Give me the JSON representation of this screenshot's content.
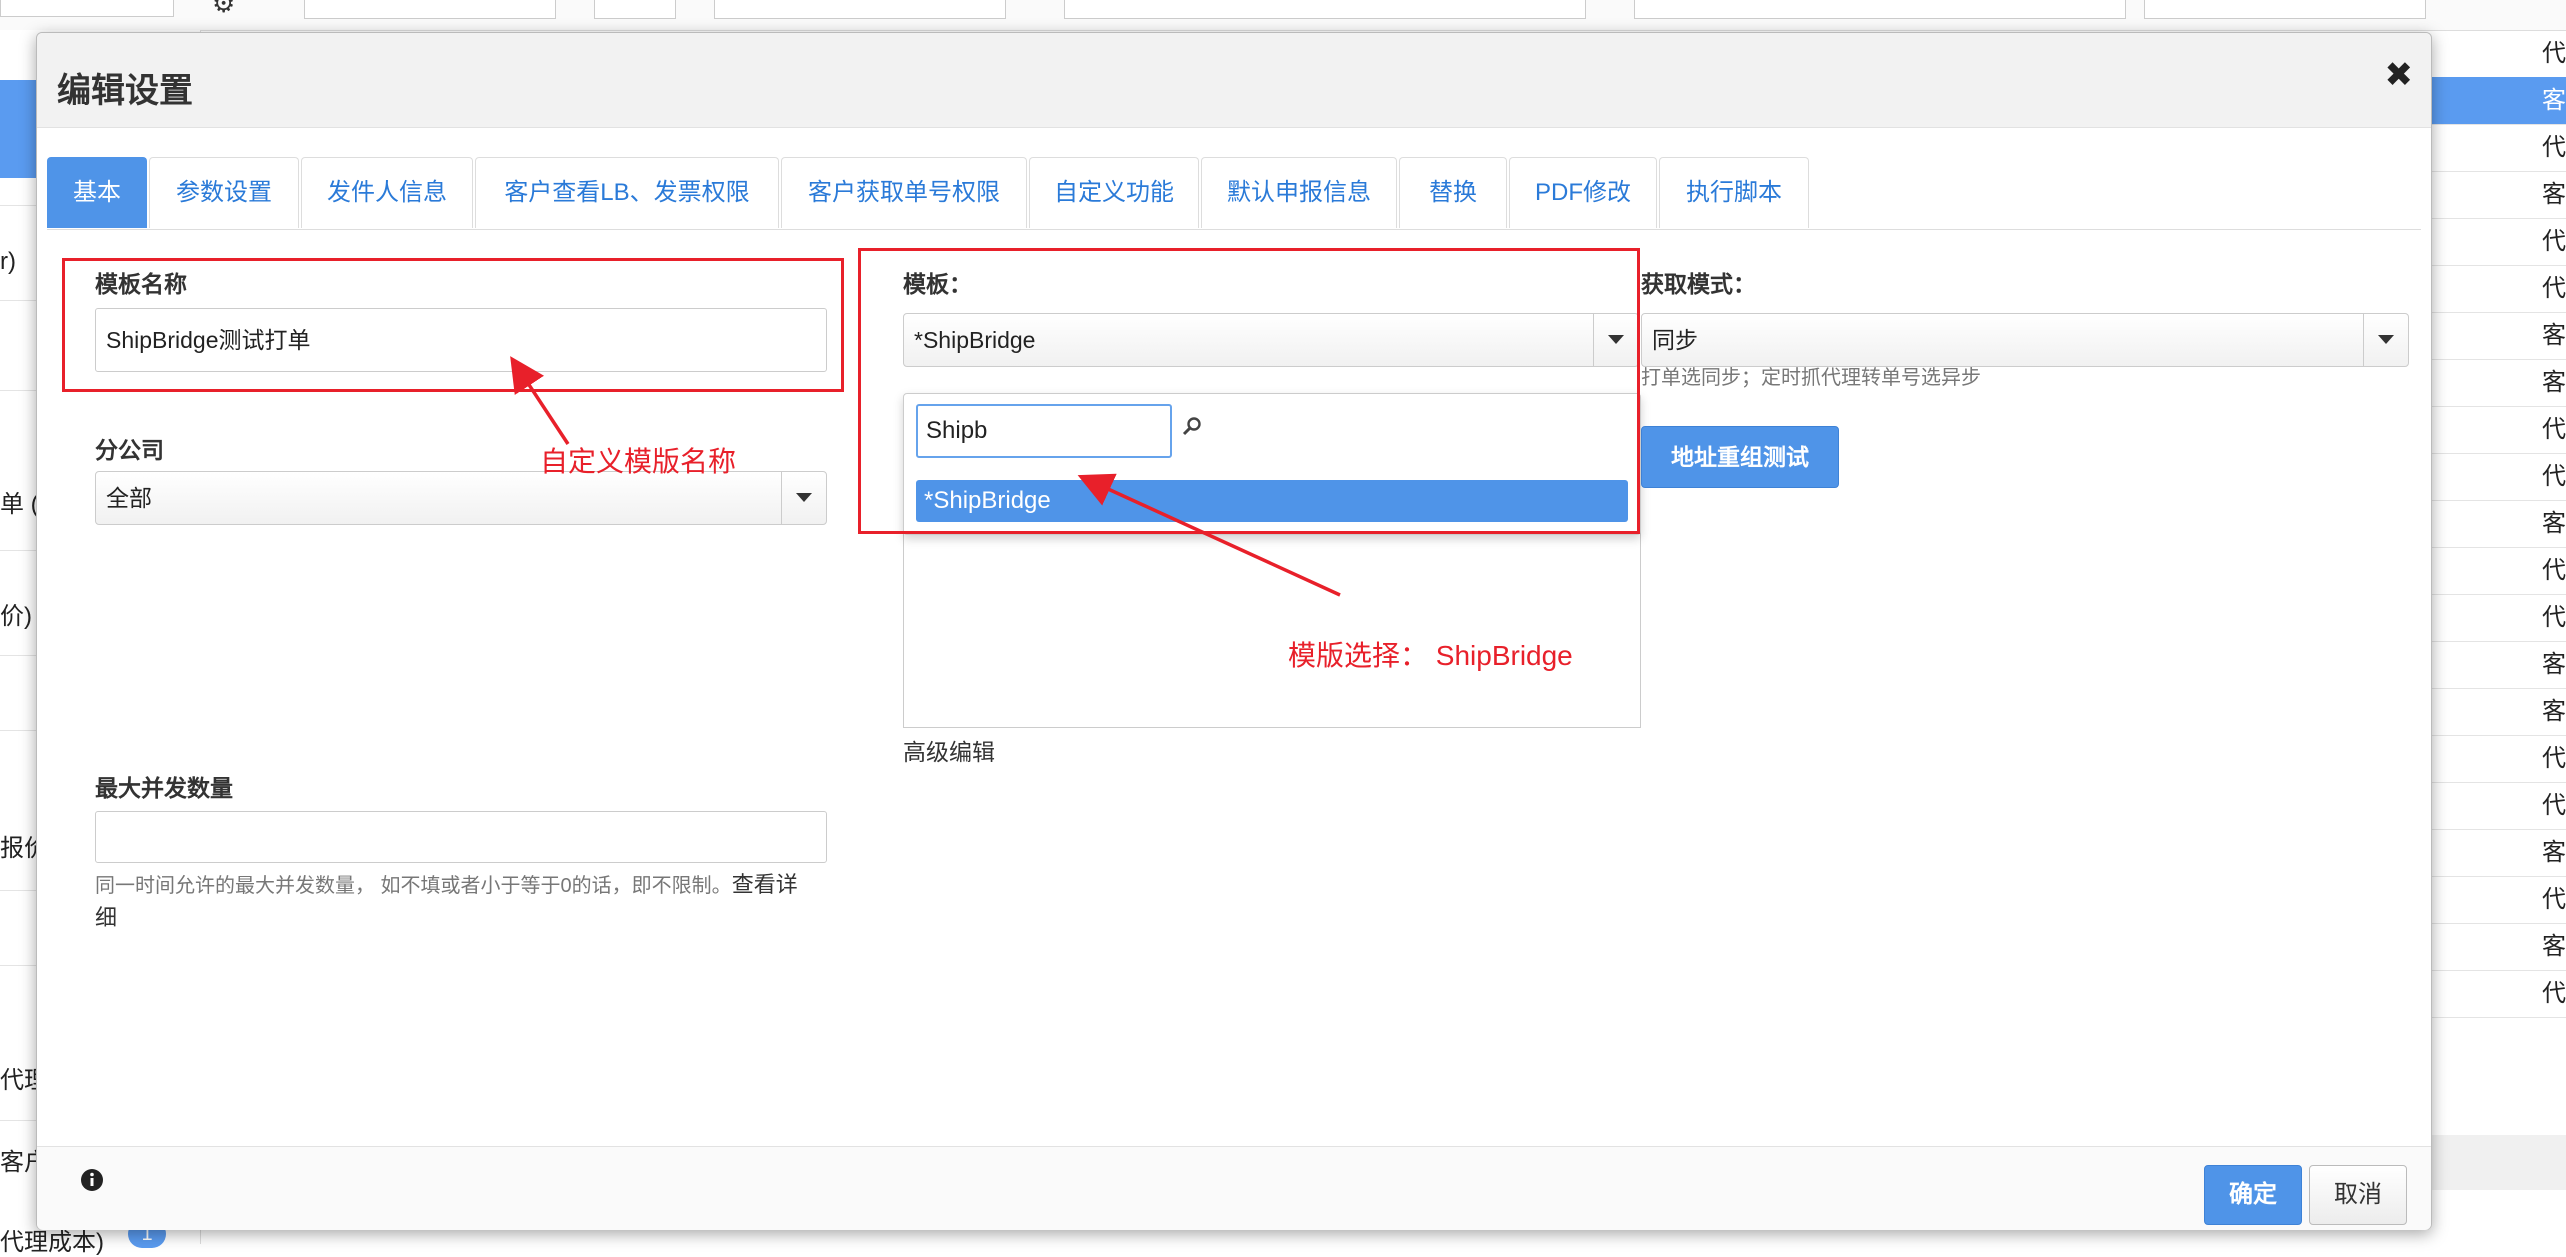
{
  "background": {
    "sidebar_items": [
      "r)",
      "单 ( 客",
      "价)",
      "报价",
      "代理",
      "客户",
      "代理成本)"
    ],
    "sidebar_badge": "1",
    "right_column_rows": [
      "代",
      "客",
      "代",
      "客",
      "代",
      "代",
      "客",
      "客",
      "代",
      "代",
      "客",
      "代",
      "代",
      "客",
      "客",
      "代",
      "代",
      "客",
      "代",
      "客",
      "代"
    ]
  },
  "modal": {
    "title": "编辑设置",
    "close_symbol": "✖",
    "tabs": [
      {
        "label": "基本",
        "active": true
      },
      {
        "label": "参数设置"
      },
      {
        "label": "发件人信息"
      },
      {
        "label": "客户查看LB、发票权限"
      },
      {
        "label": "客户获取单号权限"
      },
      {
        "label": "自定义功能"
      },
      {
        "label": "默认申报信息"
      },
      {
        "label": "替换"
      },
      {
        "label": "PDF修改"
      },
      {
        "label": "执行脚本"
      }
    ],
    "template_name": {
      "label": "模板名称",
      "value": "ShipBridge测试打单"
    },
    "branch": {
      "label": "分公司",
      "value": "全部"
    },
    "max_concurrency": {
      "label": "最大并发数量",
      "value": "",
      "help": "同一时间允许的最大并发数量， 如不填或者小于等于0的话，即不限制。",
      "help_link": "查看详",
      "help_link_tail": "细"
    },
    "template": {
      "label": "模板：",
      "value": "*ShipBridge",
      "search_value": "Shipb",
      "options": [
        "*ShipBridge"
      ],
      "advanced_edit": "高级编辑"
    },
    "fetch_mode": {
      "label": "获取模式：",
      "value": "同步",
      "help": "打单选同步；定时抓代理转单号选异步"
    },
    "address_test_button": "地址重组测试",
    "footer": {
      "confirm": "确定",
      "cancel": "取消"
    }
  },
  "annotations": {
    "custom_name": "自定义模版名称",
    "template_choice": "模版选择：  ShipBridge"
  },
  "colors": {
    "accent": "#4f94e8",
    "annotation_red": "#e8202a"
  },
  "icons": {
    "close": "close-icon",
    "search": "search-icon",
    "info": "info-icon",
    "caret": "chevron-down-icon",
    "settings": "gear-icon"
  }
}
